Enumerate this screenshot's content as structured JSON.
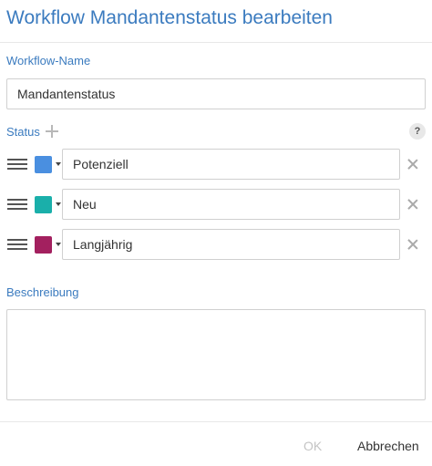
{
  "dialog": {
    "title": "Workflow Mandantenstatus bearbeiten"
  },
  "workflow_name": {
    "label": "Workflow-Name",
    "value": "Mandantenstatus"
  },
  "status": {
    "label": "Status",
    "add_icon": "plus-icon",
    "help_icon": "?",
    "items": [
      {
        "label": "Potenziell",
        "color": "#4a8fe0"
      },
      {
        "label": "Neu",
        "color": "#1aafaa"
      },
      {
        "label": "Langjährig",
        "color": "#a3205f"
      }
    ]
  },
  "description": {
    "label": "Beschreibung",
    "value": ""
  },
  "footer": {
    "ok_label": "OK",
    "cancel_label": "Abbrechen"
  }
}
